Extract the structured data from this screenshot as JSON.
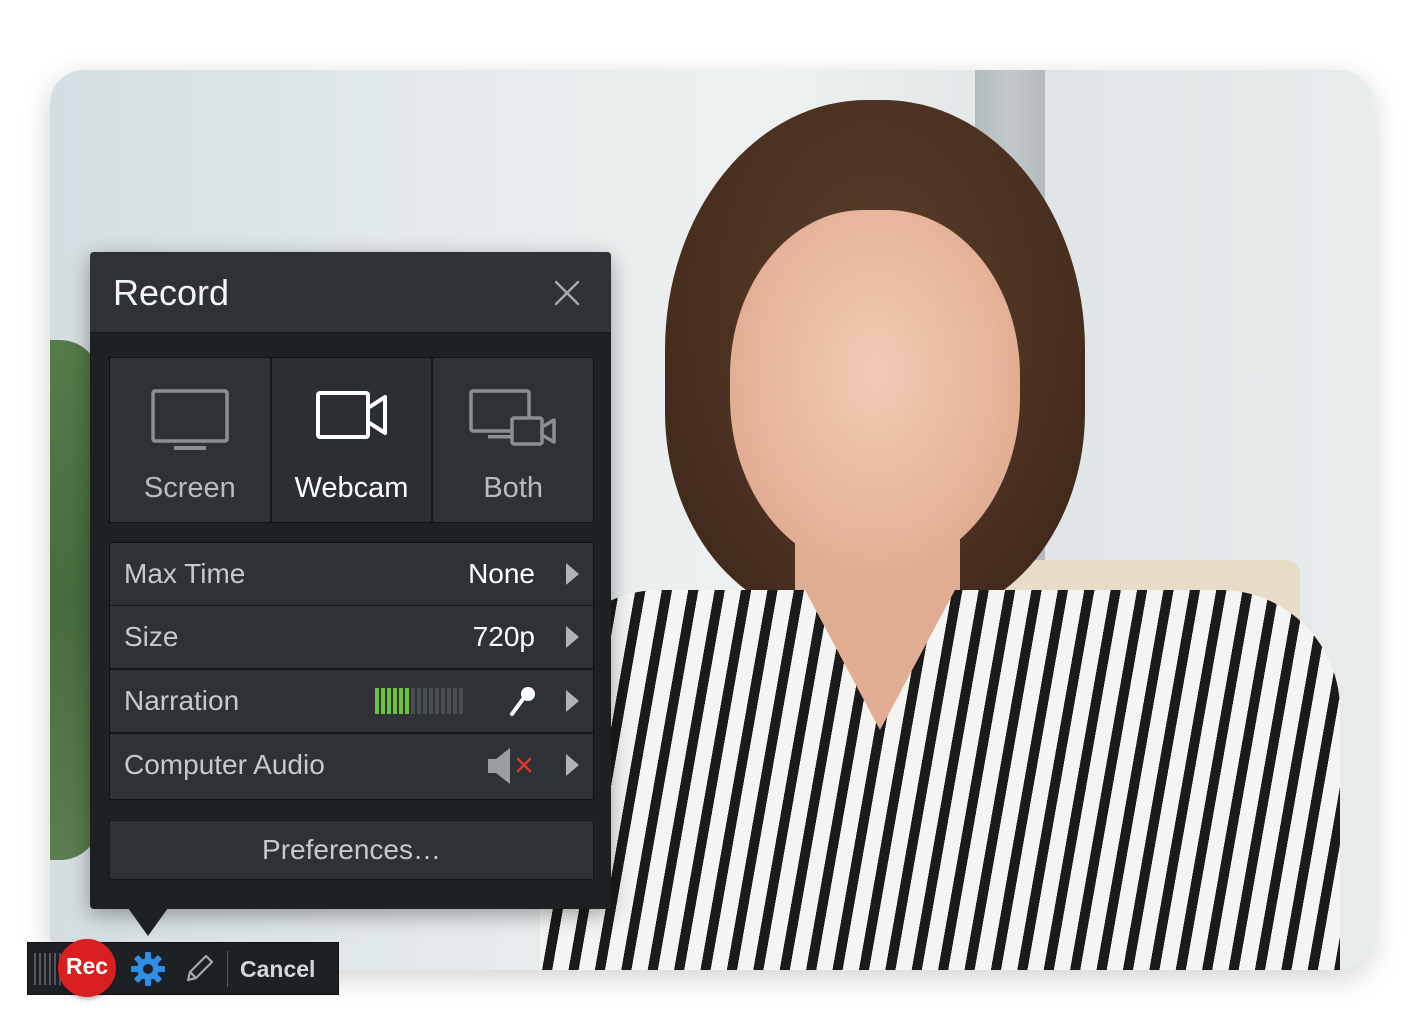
{
  "panel": {
    "title": "Record",
    "modes": [
      {
        "label": "Screen",
        "icon": "monitor-icon",
        "selected": false
      },
      {
        "label": "Webcam",
        "icon": "video-camera-icon",
        "selected": true
      },
      {
        "label": "Both",
        "icon": "monitor-and-camera-icon",
        "selected": false
      }
    ],
    "settings": {
      "max_time": {
        "label": "Max Time",
        "value": "None"
      },
      "size": {
        "label": "Size",
        "value": "720p"
      },
      "narration": {
        "label": "Narration",
        "meter_level": 0.4,
        "icon": "microphone-icon"
      },
      "computer_audio": {
        "label": "Computer Audio",
        "icon": "speaker-muted-icon",
        "muted": true
      }
    },
    "preferences_label": "Preferences…"
  },
  "toolbar": {
    "rec_label": "Rec",
    "cancel_label": "Cancel"
  },
  "colors": {
    "rec_red": "#d91f1f",
    "meter_green": "#6cc23a",
    "gear_blue": "#2f8fe6",
    "mute_red": "#e0342c"
  }
}
